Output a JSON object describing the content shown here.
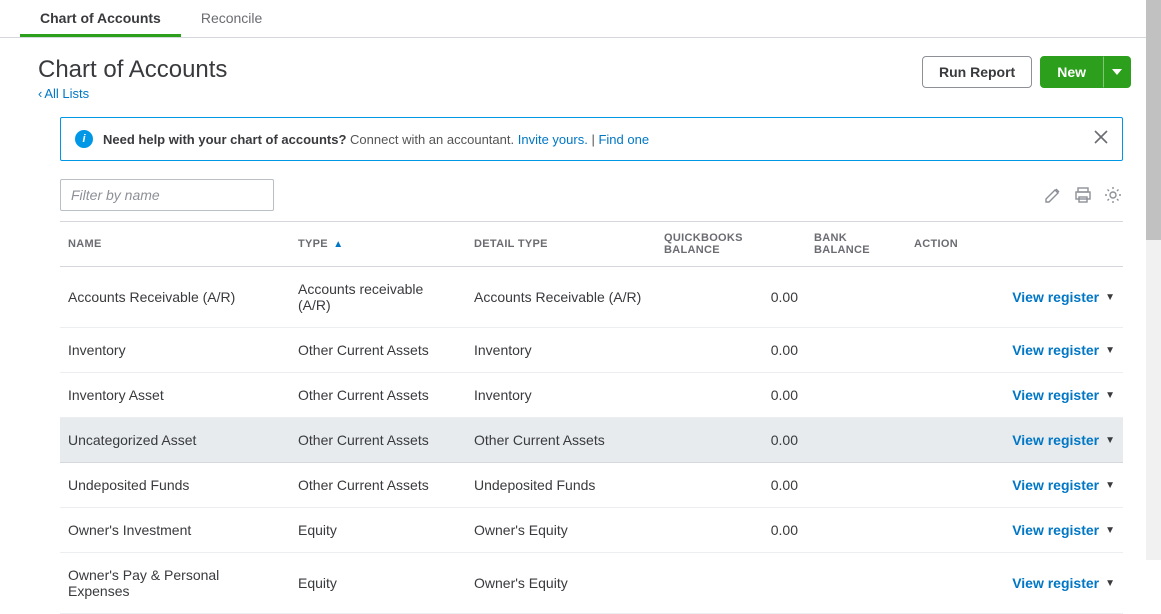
{
  "tabs": [
    {
      "label": "Chart of Accounts",
      "active": true
    },
    {
      "label": "Reconcile",
      "active": false
    }
  ],
  "page": {
    "title": "Chart of Accounts",
    "breadcrumb": "All Lists"
  },
  "headerActions": {
    "runReport": "Run Report",
    "newLabel": "New"
  },
  "infoBar": {
    "strong": "Need help with your chart of accounts?",
    "text": "Connect with an accountant.",
    "invite": "Invite yours.",
    "separator": "|",
    "find": "Find one"
  },
  "filter": {
    "placeholder": "Filter by name"
  },
  "columns": {
    "name": "NAME",
    "type": "TYPE",
    "detail": "DETAIL TYPE",
    "qbBalance": "QUICKBOOKS BALANCE",
    "bankBalance": "BANK BALANCE",
    "action": "ACTION"
  },
  "actionLabel": "View register",
  "rows": [
    {
      "name": "Accounts Receivable (A/R)",
      "type": "Accounts receivable (A/R)",
      "detail": "Accounts Receivable (A/R)",
      "qb": "0.00",
      "bank": "",
      "selected": false
    },
    {
      "name": "Inventory",
      "type": "Other Current Assets",
      "detail": "Inventory",
      "qb": "0.00",
      "bank": "",
      "selected": false
    },
    {
      "name": "Inventory Asset",
      "type": "Other Current Assets",
      "detail": "Inventory",
      "qb": "0.00",
      "bank": "",
      "selected": false
    },
    {
      "name": "Uncategorized Asset",
      "type": "Other Current Assets",
      "detail": "Other Current Assets",
      "qb": "0.00",
      "bank": "",
      "selected": true
    },
    {
      "name": "Undeposited Funds",
      "type": "Other Current Assets",
      "detail": "Undeposited Funds",
      "qb": "0.00",
      "bank": "",
      "selected": false
    },
    {
      "name": "Owner's Investment",
      "type": "Equity",
      "detail": "Owner's Equity",
      "qb": "0.00",
      "bank": "",
      "selected": false
    },
    {
      "name": "Owner's Pay & Personal Expenses",
      "type": "Equity",
      "detail": "Owner's Equity",
      "qb": "",
      "bank": "",
      "selected": false
    }
  ]
}
